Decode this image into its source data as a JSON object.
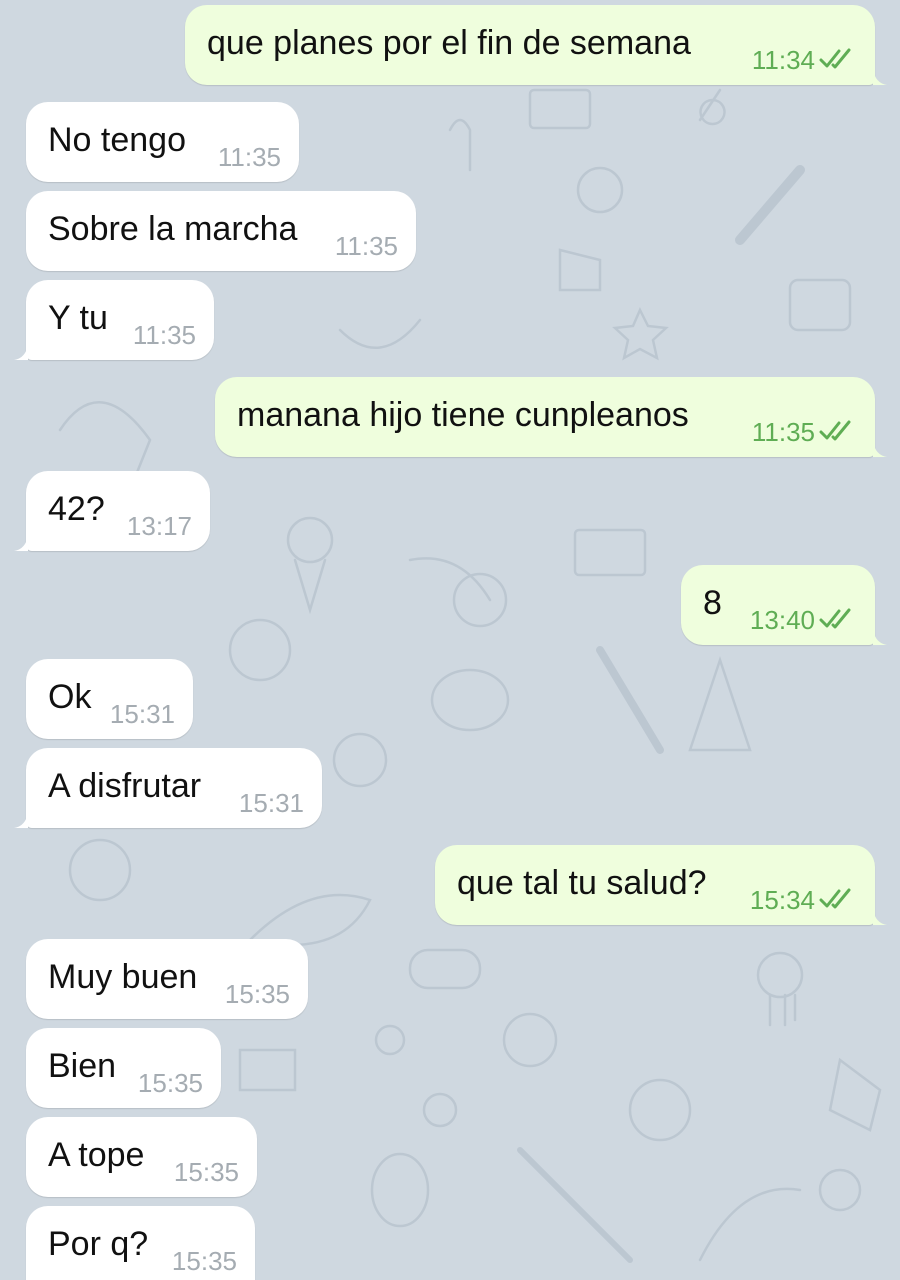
{
  "theme": {
    "background": "#cfd8e0",
    "incoming_bubble": "#ffffff",
    "outgoing_bubble": "#effedd",
    "outgoing_time_color": "#5fad54",
    "incoming_time_color": "#a5acb2",
    "check_icon": "double-check-icon"
  },
  "messages": [
    {
      "direction": "out",
      "text": "que planes por el fin de semana",
      "time": "11:34",
      "read": true
    },
    {
      "direction": "in",
      "text": "No tengo",
      "time": "11:35"
    },
    {
      "direction": "in",
      "text": "Sobre la marcha",
      "time": "11:35"
    },
    {
      "direction": "in",
      "text": "Y tu",
      "time": "11:35"
    },
    {
      "direction": "out",
      "text": "manana hijo tiene cunpleanos",
      "time": "11:35",
      "read": true
    },
    {
      "direction": "in",
      "text": "42?",
      "time": "13:17"
    },
    {
      "direction": "out",
      "text": "8",
      "time": "13:40",
      "read": true
    },
    {
      "direction": "in",
      "text": "Ok",
      "time": "15:31"
    },
    {
      "direction": "in",
      "text": "A disfrutar",
      "time": "15:31"
    },
    {
      "direction": "out",
      "text": "que tal tu salud?",
      "time": "15:34",
      "read": true
    },
    {
      "direction": "in",
      "text": "Muy buen",
      "time": "15:35"
    },
    {
      "direction": "in",
      "text": "Bien",
      "time": "15:35"
    },
    {
      "direction": "in",
      "text": "A tope",
      "time": "15:35"
    },
    {
      "direction": "in",
      "text": "Por q?",
      "time": "15:35"
    }
  ]
}
